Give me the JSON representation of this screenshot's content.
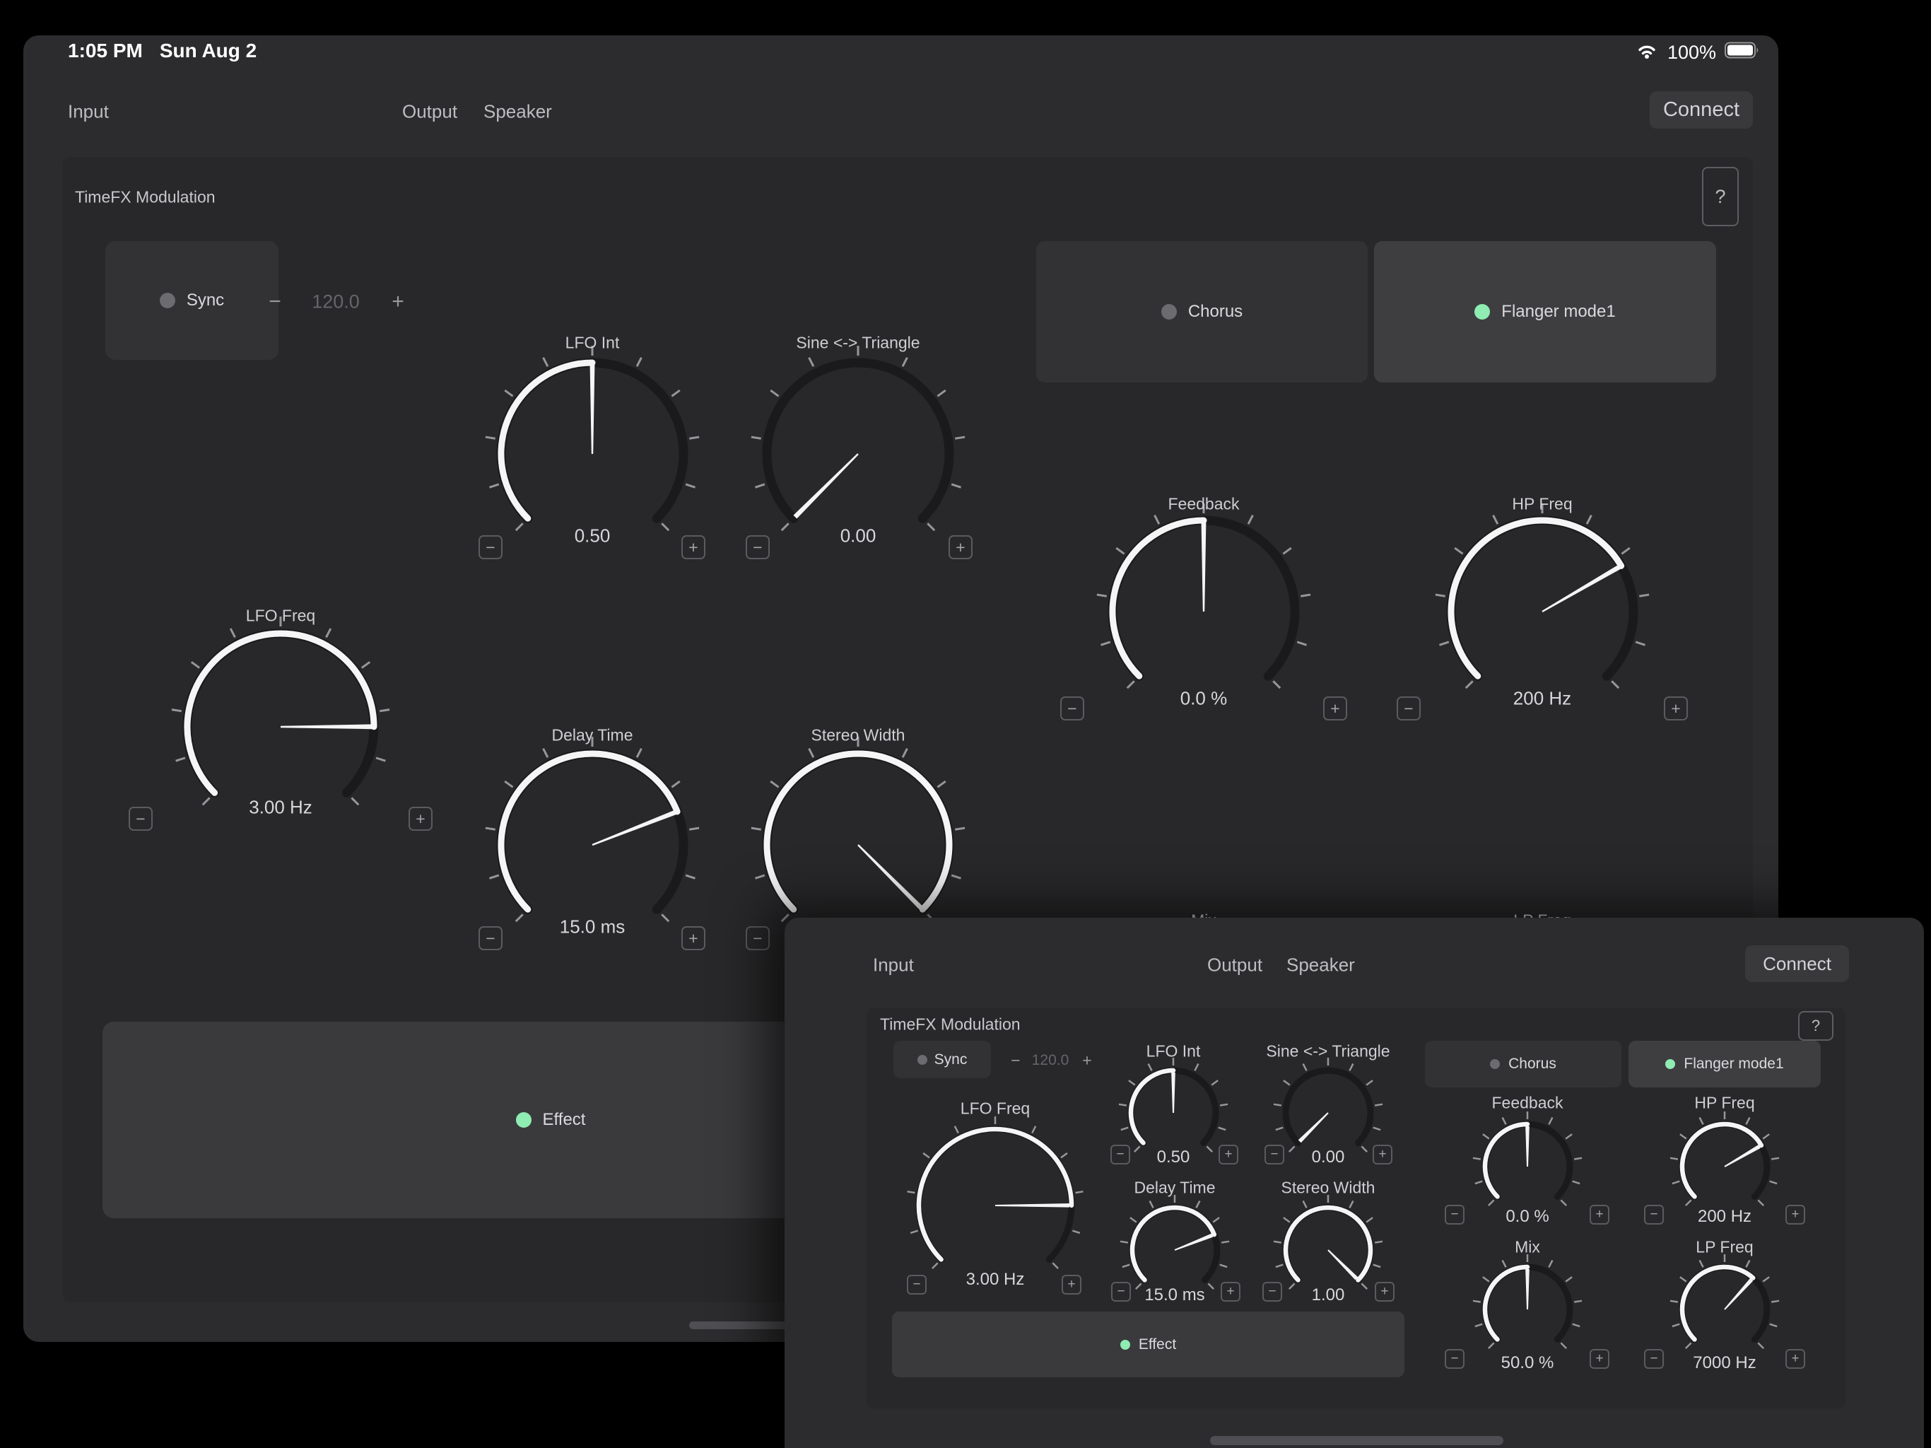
{
  "app": {
    "status_bar": {
      "time": "1:05 PM",
      "date": "Sun Aug 2",
      "battery_percent": "100%"
    },
    "nav": {
      "input": "Input",
      "output": "Output",
      "speaker": "Speaker",
      "connect": "Connect"
    },
    "panel": {
      "title": "TimeFX Modulation",
      "help_label": "?",
      "sync": {
        "label": "Sync",
        "enabled": false
      },
      "tempo": {
        "minus": "−",
        "value": "120.0",
        "plus": "+"
      },
      "modes": [
        {
          "label": "Chorus",
          "selected": false
        },
        {
          "label": "Flanger mode1",
          "selected": true
        }
      ],
      "effect": {
        "label": "Effect",
        "enabled": true
      },
      "knob_minus": "−",
      "knob_plus": "+"
    },
    "knobs": {
      "lfo_freq": {
        "label": "LFO Freq",
        "value": "3.00 Hz",
        "fraction": 0.833
      },
      "lfo_int": {
        "label": "LFO Int",
        "value": "0.50",
        "fraction": 0.5
      },
      "sine_tri": {
        "label": "Sine <-> Triangle",
        "value": "0.00",
        "fraction": 0.0
      },
      "delay_time": {
        "label": "Delay Time",
        "value": "15.0 ms",
        "fraction": 0.754
      },
      "stereo_width": {
        "label": "Stereo Width",
        "value": "1.00",
        "fraction": 1.0
      },
      "feedback": {
        "label": "Feedback",
        "value": "0.0 %",
        "fraction": 0.5
      },
      "hp_freq": {
        "label": "HP Freq",
        "value": "200 Hz",
        "fraction": 0.722
      },
      "mix": {
        "label": "Mix",
        "value": "50.0 %",
        "fraction": 0.5
      },
      "lp_freq": {
        "label": "LP Freq",
        "value": "7000 Hz",
        "fraction": 0.656
      }
    }
  },
  "colors": {
    "accent_green": "#8fecb2",
    "window_bg": "#2c2c2e",
    "panel_bg": "#28282a",
    "knob_track": "#1a1a1c",
    "knob_arc": "#f5f5f6",
    "tick": "#97979b"
  }
}
